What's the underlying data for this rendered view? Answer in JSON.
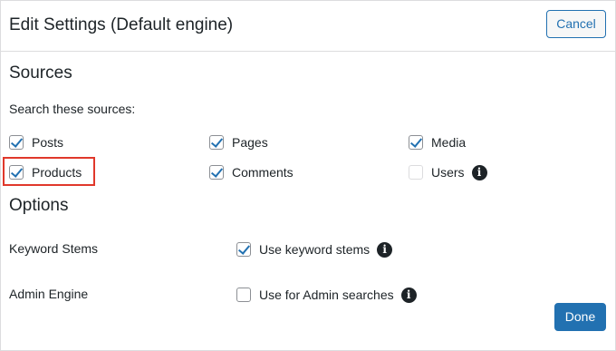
{
  "header": {
    "title": "Edit Settings (Default engine)",
    "cancel_label": "Cancel"
  },
  "sources": {
    "heading": "Sources",
    "prompt": "Search these sources:",
    "items": [
      {
        "label": "Posts",
        "checked": true
      },
      {
        "label": "Pages",
        "checked": true
      },
      {
        "label": "Media",
        "checked": true
      },
      {
        "label": "Products",
        "checked": true,
        "highlighted": true
      },
      {
        "label": "Comments",
        "checked": true
      },
      {
        "label": "Users",
        "checked": false,
        "icon": "info-icon"
      }
    ]
  },
  "options": {
    "heading": "Options",
    "rows": [
      {
        "label": "Keyword Stems",
        "option_label": "Use keyword stems",
        "checked": true,
        "icon": "info-icon"
      },
      {
        "label": "Admin Engine",
        "option_label": "Use for Admin searches",
        "checked": false,
        "icon": "info-icon"
      }
    ]
  },
  "footer": {
    "done_label": "Done"
  },
  "colors": {
    "accent": "#2271b1",
    "highlight": "#e0382b",
    "text": "#1d2327",
    "border": "#dcdcde"
  },
  "icons": {
    "info": "i"
  }
}
